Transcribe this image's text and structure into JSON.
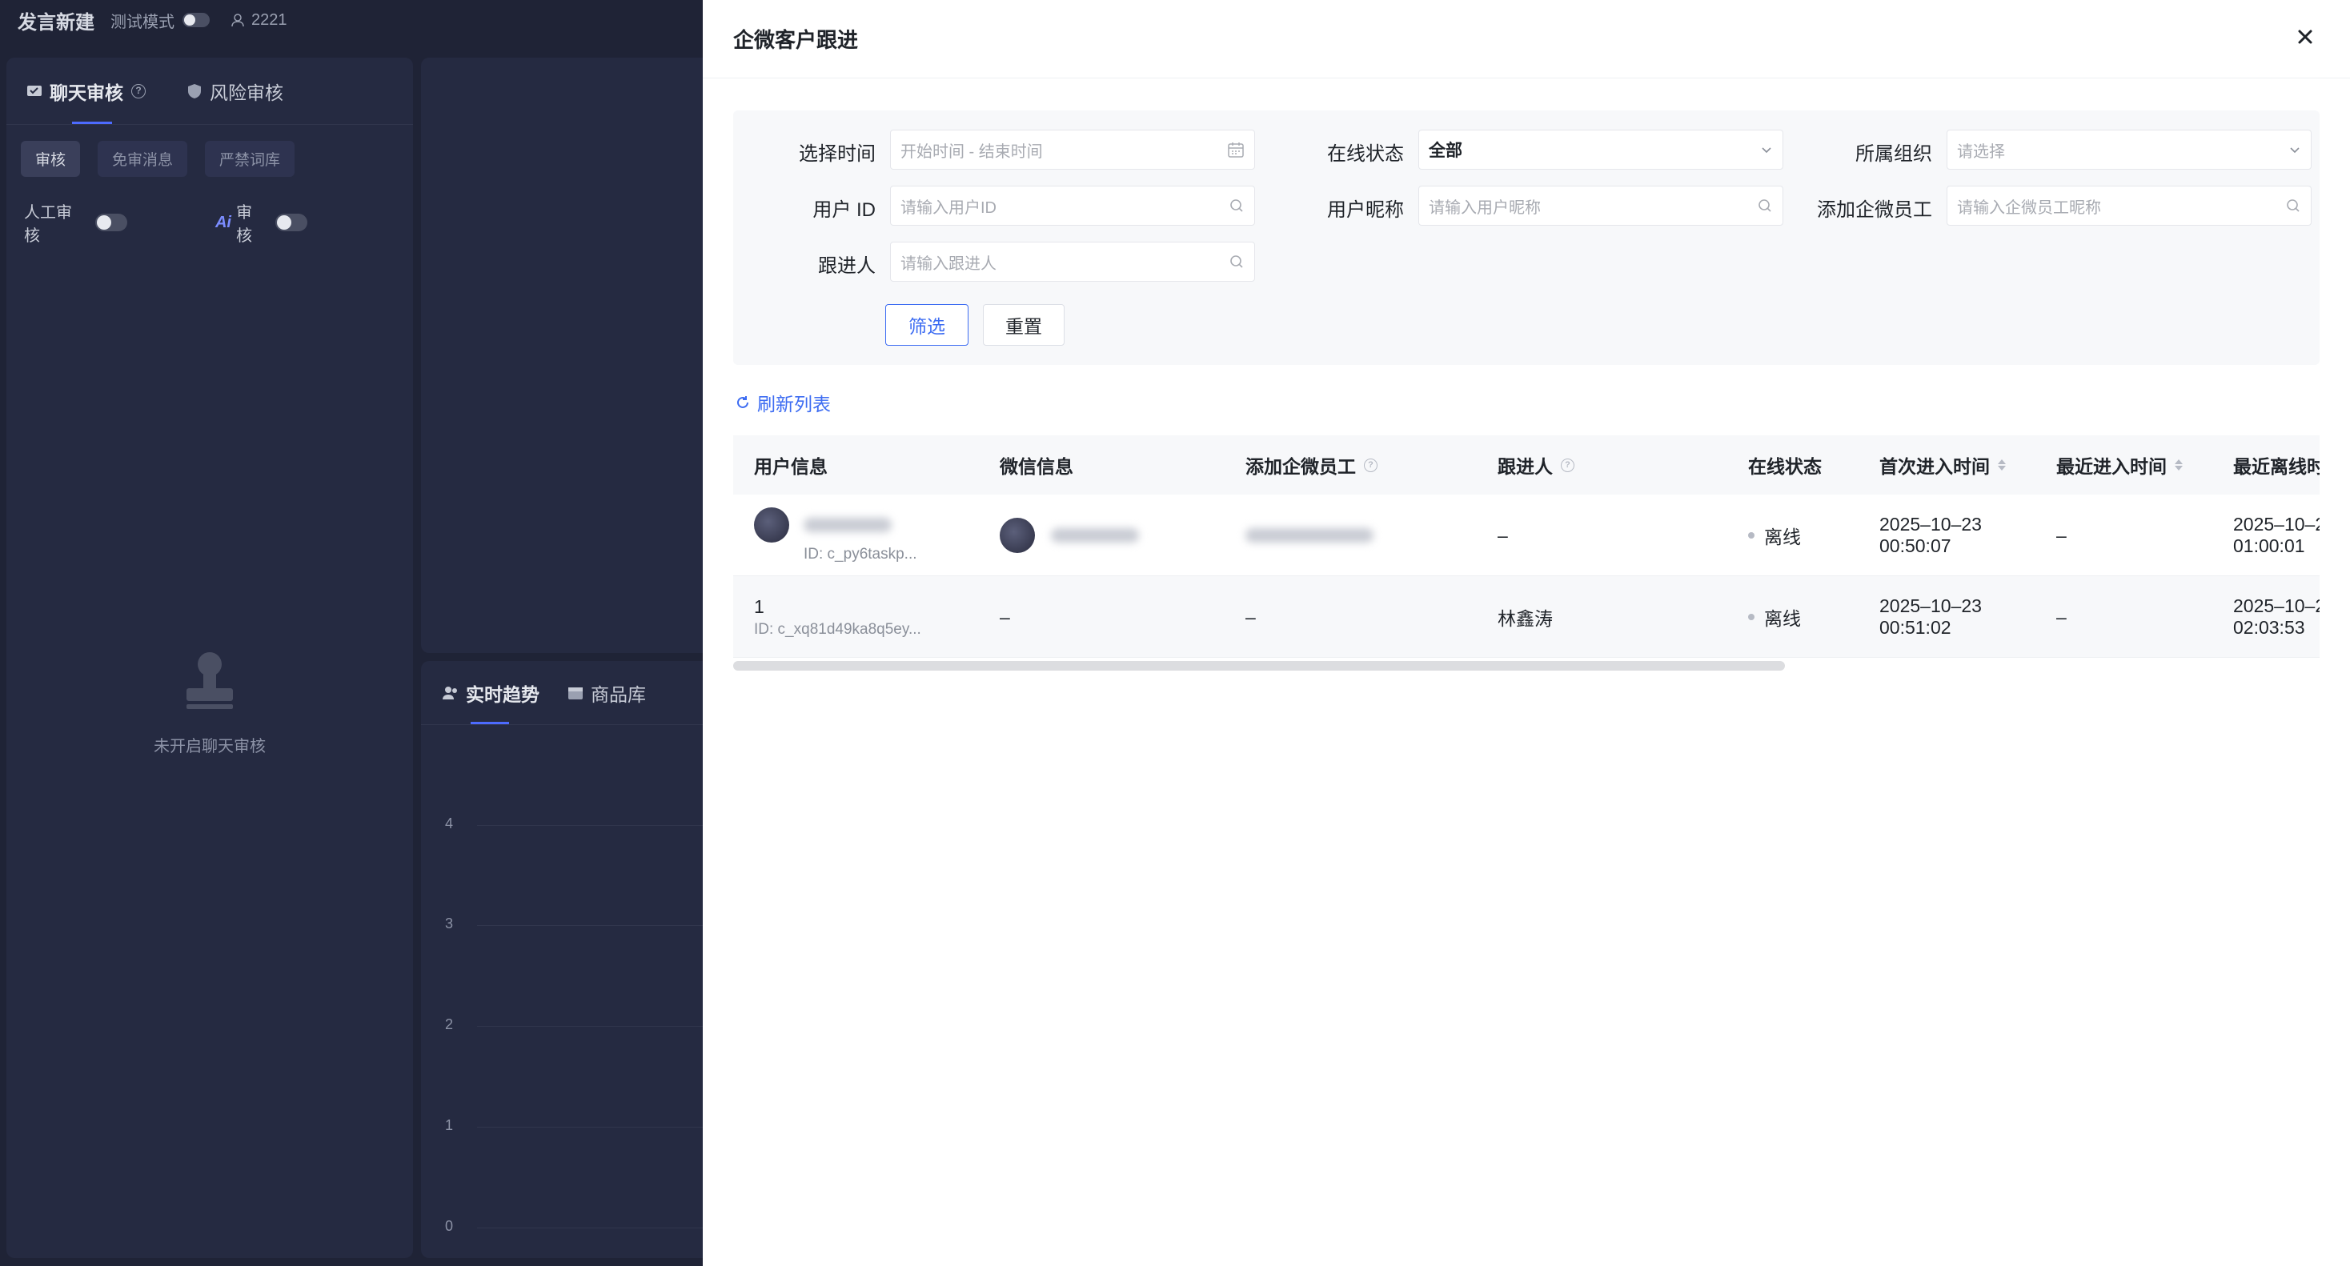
{
  "app": {
    "title": "发言新建",
    "test_mode_label": "测试模式",
    "user_count": "2221"
  },
  "left_panel": {
    "tabs": [
      {
        "label": "聊天审核"
      },
      {
        "label": "风险审核"
      }
    ],
    "chips": [
      "审核",
      "免审消息",
      "严禁词库"
    ],
    "toggles": [
      {
        "label": "人工审核"
      },
      {
        "ai_mark": "Ai",
        "label": "审核"
      }
    ],
    "empty_text": "未开启聊天审核"
  },
  "mid_panel": {
    "tabs": [
      {
        "label": "实时趋势"
      },
      {
        "label": "商品库"
      }
    ],
    "y_ticks": [
      "4",
      "3",
      "2",
      "1",
      "0"
    ]
  },
  "drawer": {
    "title": "企微客户跟进",
    "filters": {
      "time": {
        "label": "选择时间",
        "placeholder": "开始时间 - 结束时间"
      },
      "online": {
        "label": "在线状态",
        "value": "全部"
      },
      "org": {
        "label": "所属组织",
        "placeholder": "请选择"
      },
      "user_id": {
        "label": "用户 ID",
        "placeholder": "请输入用户ID"
      },
      "nickname": {
        "label": "用户昵称",
        "placeholder": "请输入用户昵称"
      },
      "staff": {
        "label": "添加企微员工",
        "placeholder": "请输入企微员工昵称"
      },
      "follower": {
        "label": "跟进人",
        "placeholder": "请输入跟进人"
      }
    },
    "buttons": {
      "filter": "筛选",
      "reset": "重置"
    },
    "refresh_label": "刷新列表",
    "table": {
      "columns": [
        "用户信息",
        "微信信息",
        "添加企微员工",
        "跟进人",
        "在线状态",
        "首次进入时间",
        "最近进入时间",
        "最近离线时"
      ],
      "rows": [
        {
          "user_name": "",
          "user_id": "ID: c_py6taskp...",
          "wechat": "",
          "staff": "",
          "follower": "–",
          "status": "离线",
          "first_date": "2025–10–23",
          "first_time": "00:50:07",
          "recent": "–",
          "offline_date": "2025–10–2",
          "offline_time": "01:00:01"
        },
        {
          "user_name": "1",
          "user_id": "ID: c_xq81d49ka8q5ey...",
          "wechat": "–",
          "staff": "–",
          "follower": "林鑫涛",
          "status": "离线",
          "first_date": "2025–10–23",
          "first_time": "00:51:02",
          "recent": "–",
          "offline_date": "2025–10–2",
          "offline_time": "02:03:53"
        }
      ]
    },
    "colors": {
      "primary": "#3d6cf2",
      "status_offline": "#b6bac4"
    }
  }
}
